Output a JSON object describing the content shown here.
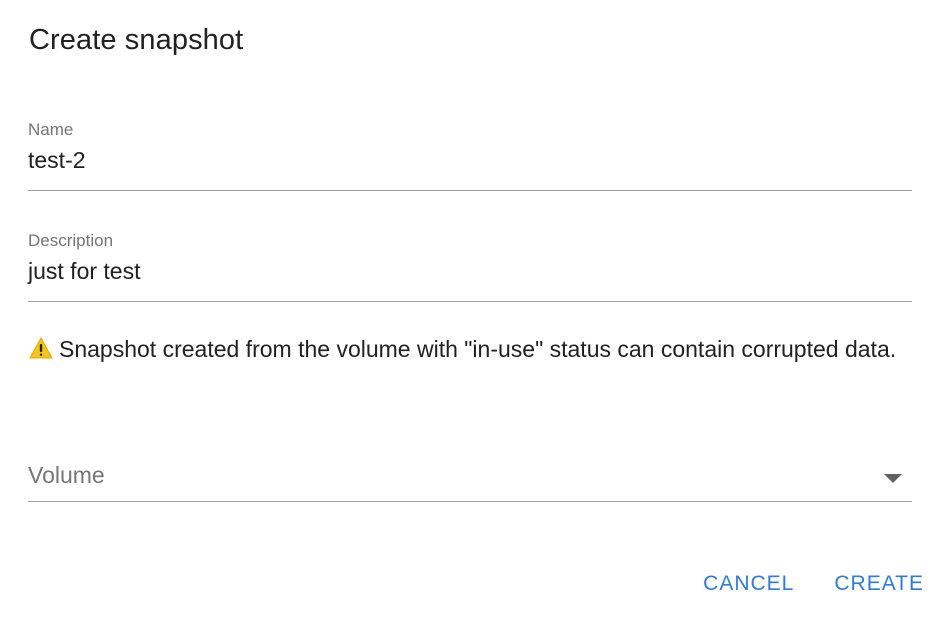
{
  "dialog": {
    "title": "Create snapshot",
    "name_field": {
      "label": "Name",
      "value": "test-2"
    },
    "description_field": {
      "label": "Description",
      "value": "just for test"
    },
    "warning": {
      "icon": "warning-icon",
      "icon_color": "#f5c518",
      "text": "Snapshot created from the volume with \"in-use\" status can contain corrupted data."
    },
    "volume_select": {
      "placeholder": "Volume",
      "selected": ""
    },
    "actions": {
      "cancel_label": "CANCEL",
      "create_label": "CREATE"
    },
    "accent_color": "#2f7bd8"
  }
}
